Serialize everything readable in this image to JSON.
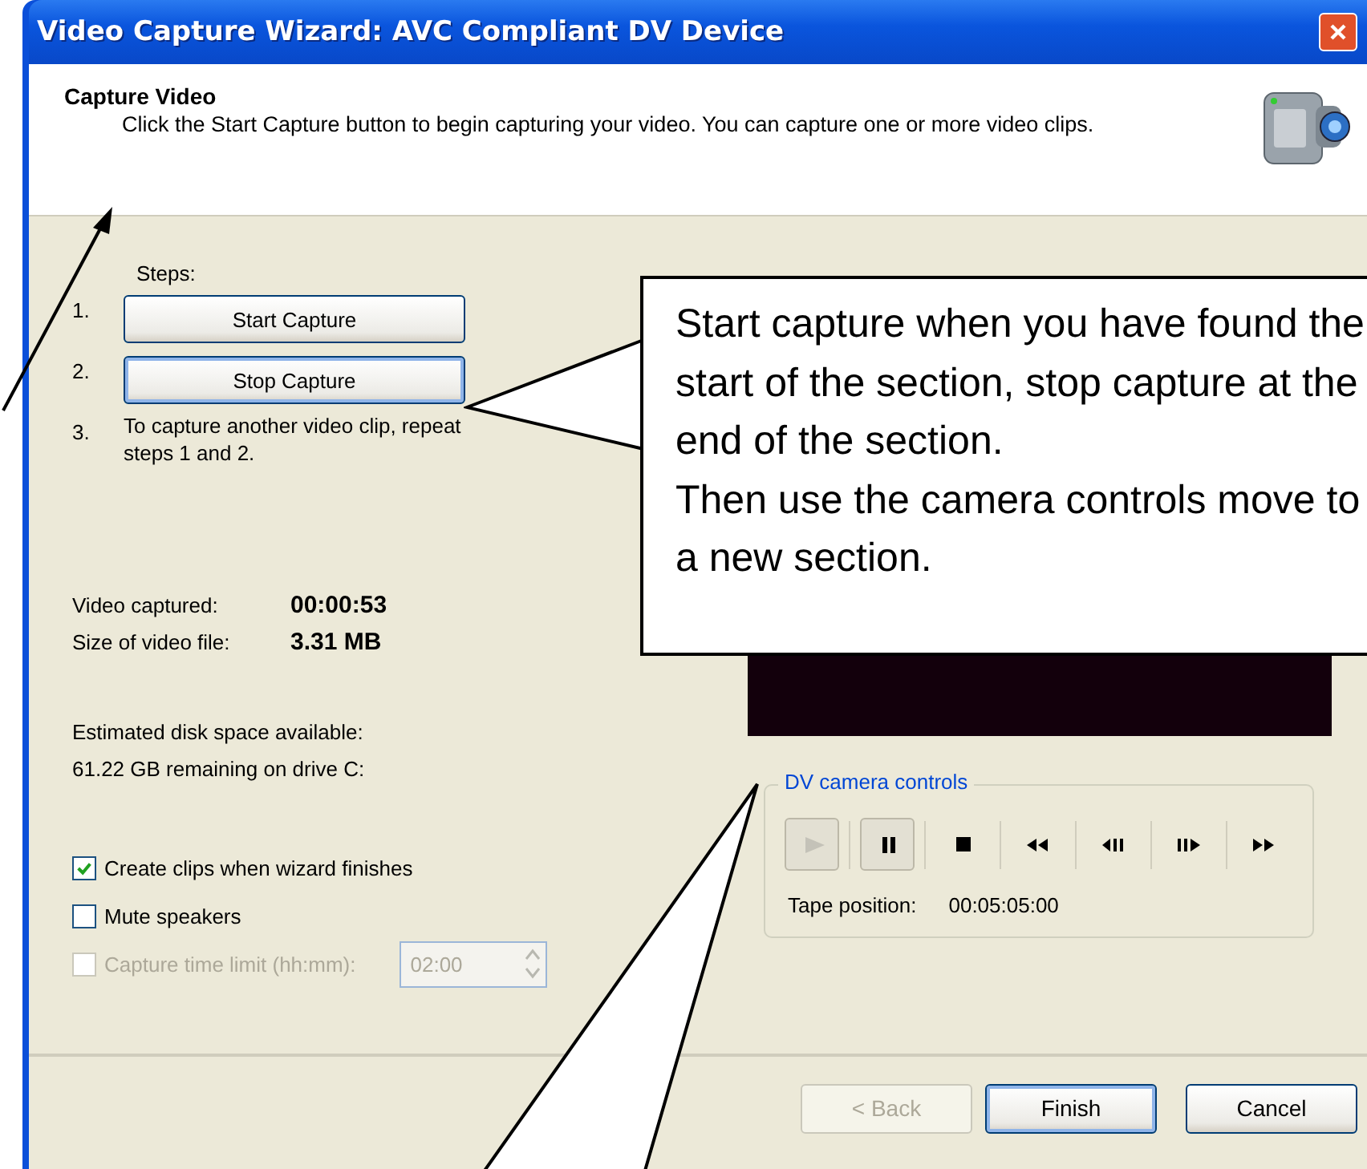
{
  "window": {
    "title": "Video Capture Wizard: AVC Compliant DV Device"
  },
  "header": {
    "title": "Capture Video",
    "description": "Click the Start Capture button to begin capturing your video. You can capture one or more video clips."
  },
  "steps": {
    "label": "Steps:",
    "items": [
      {
        "number": "1.",
        "kind": "button",
        "text": "Start Capture",
        "focused": false
      },
      {
        "number": "2.",
        "kind": "button",
        "text": "Stop Capture",
        "focused": true
      },
      {
        "number": "3.",
        "kind": "text",
        "text": "To capture another video clip, repeat steps 1 and 2."
      }
    ]
  },
  "stats": [
    {
      "label": "Video captured:",
      "value": "00:00:53"
    },
    {
      "label": "Size of video file:",
      "value": "3.31 MB"
    }
  ],
  "disk": {
    "label": "Estimated disk space available:",
    "value": "61.22 GB remaining on drive C:"
  },
  "options": [
    {
      "label": "Create clips when wizard finishes",
      "checked": true,
      "disabled": false
    },
    {
      "label": "Mute speakers",
      "checked": false,
      "disabled": false
    },
    {
      "label": "Capture time limit (hh:mm):",
      "checked": false,
      "disabled": true
    }
  ],
  "time_limit": {
    "value": "02:00",
    "disabled": true
  },
  "camera_controls": {
    "title": "DV camera controls",
    "buttons": [
      {
        "kind": "play",
        "pressed": true,
        "disabled": true
      },
      {
        "kind": "pause",
        "pressed": true,
        "disabled": false
      },
      {
        "kind": "stop",
        "pressed": false,
        "disabled": false
      },
      {
        "kind": "rewind",
        "pressed": false,
        "disabled": false
      },
      {
        "kind": "step-back",
        "pressed": false,
        "disabled": false
      },
      {
        "kind": "step-forward",
        "pressed": false,
        "disabled": false
      },
      {
        "kind": "fast-forward",
        "pressed": false,
        "disabled": false
      }
    ],
    "tape_label": "Tape position:",
    "tape_value": "00:05:05:00"
  },
  "buttons": [
    {
      "label": "< Back",
      "disabled": true,
      "default": false
    },
    {
      "label": "Finish",
      "disabled": false,
      "default": true
    },
    {
      "label": "Cancel",
      "disabled": false,
      "default": false
    }
  ],
  "annotations": [
    {
      "kind": "callout",
      "text": "Start capture when you have found the start of the section, stop capture at the end of the section.\nThen use the camera controls move to a new section."
    },
    {
      "kind": "arrow"
    },
    {
      "kind": "pointer"
    }
  ]
}
